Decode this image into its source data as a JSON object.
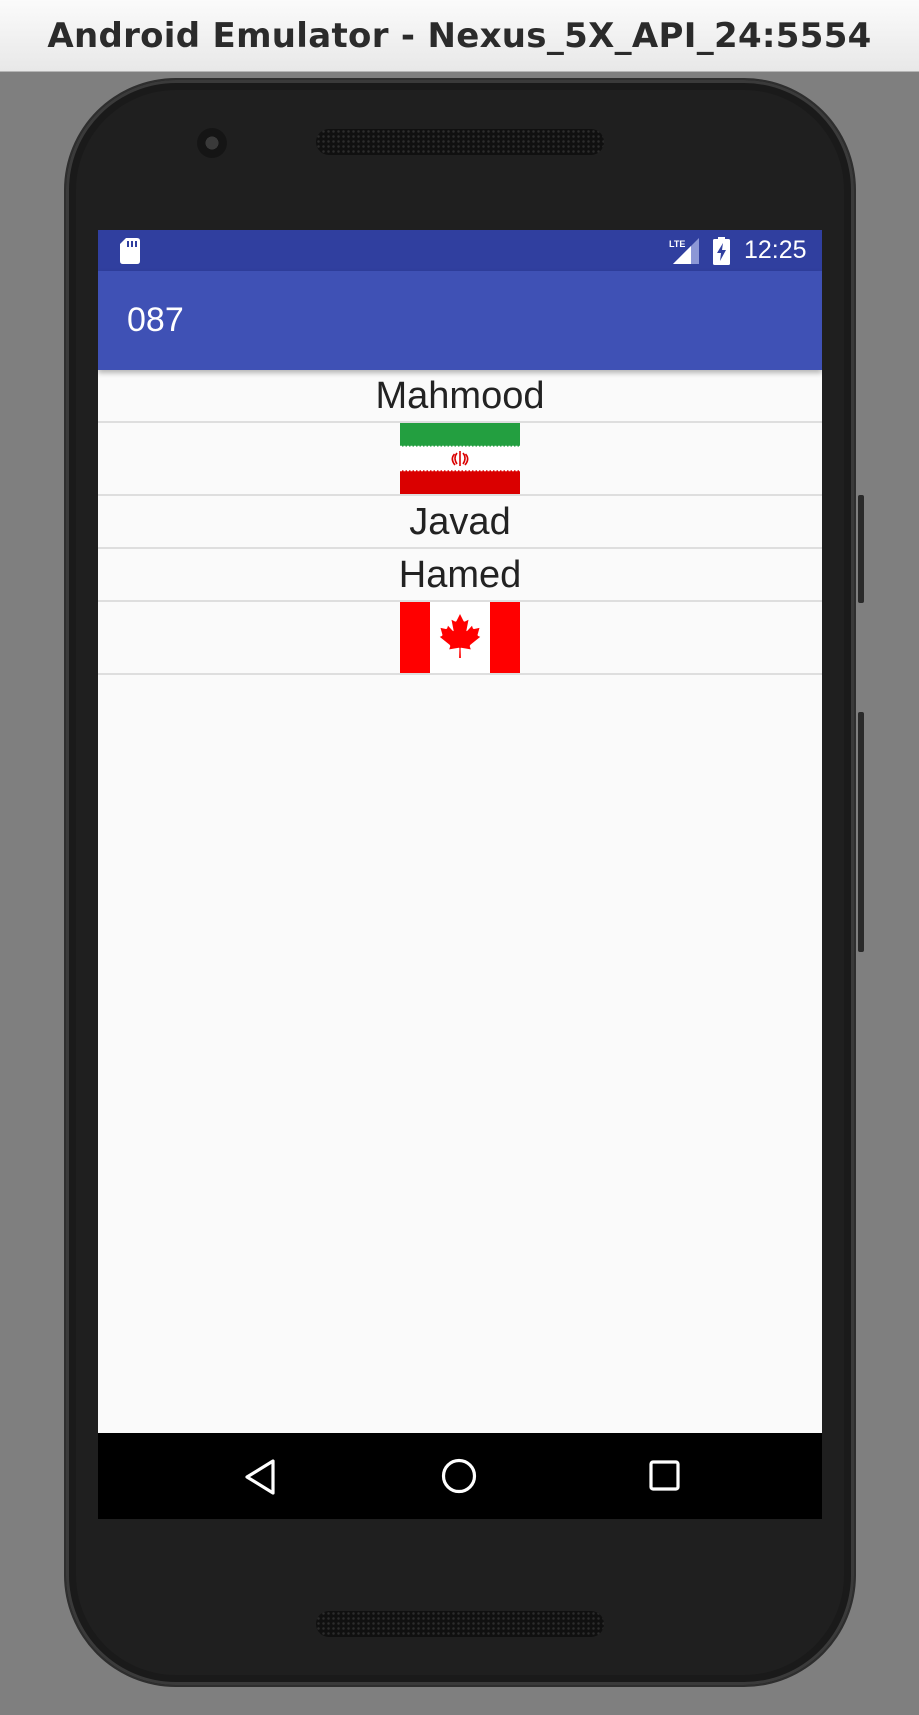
{
  "window": {
    "title": "Android Emulator - Nexus_5X_API_24:5554"
  },
  "statusbar": {
    "time": "12:25",
    "network_label": "LTE",
    "icons": [
      "sd-card-icon",
      "lte-signal-icon",
      "battery-charging-icon"
    ]
  },
  "appbar": {
    "title": "087"
  },
  "list": {
    "items": [
      {
        "type": "text",
        "label": "Mahmood"
      },
      {
        "type": "image",
        "icon": "iran-flag"
      },
      {
        "type": "text",
        "label": "Javad"
      },
      {
        "type": "text",
        "label": "Hamed"
      },
      {
        "type": "image",
        "icon": "canada-flag"
      }
    ]
  },
  "navbar": {
    "buttons": [
      "back-icon",
      "home-icon",
      "recents-icon"
    ]
  },
  "colors": {
    "statusbar": "#303f9f",
    "appbar": "#3f51b5",
    "background": "#fafafa",
    "emulator_backdrop": "#7f7f7f"
  }
}
